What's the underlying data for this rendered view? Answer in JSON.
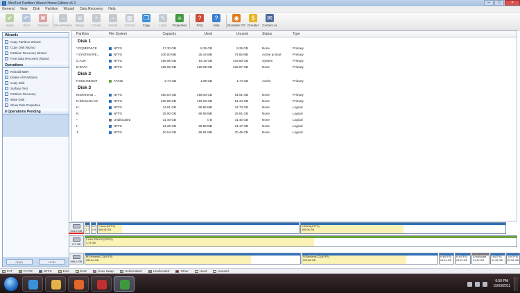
{
  "window": {
    "title": "MiniTool Partition Wizard Home Edition v5.2"
  },
  "menu": [
    "General",
    "View",
    "Disk",
    "Partition",
    "Wizard",
    "Data Recovery",
    "Help"
  ],
  "toolbar": [
    {
      "label": "Apply",
      "icon": "check-icon",
      "color": "#7aa64a",
      "enabled": false
    },
    {
      "label": "Undo",
      "icon": "undo-icon",
      "color": "#6b8fc0",
      "enabled": false
    },
    {
      "label": "Discard",
      "icon": "discard-icon",
      "color": "#c04040",
      "enabled": false
    },
    {
      "sep": true
    },
    {
      "label": "Move/Resize",
      "icon": "move-resize-icon",
      "color": "#8a97a8",
      "enabled": false
    },
    {
      "label": "Merge",
      "icon": "merge-icon",
      "color": "#8a97a8",
      "enabled": false
    },
    {
      "label": "Create",
      "icon": "create-icon",
      "color": "#8a97a8",
      "enabled": false
    },
    {
      "label": "Delete",
      "icon": "delete-icon",
      "color": "#8a97a8",
      "enabled": false
    },
    {
      "label": "Format",
      "icon": "format-icon",
      "color": "#8a97a8",
      "enabled": false
    },
    {
      "label": "Copy",
      "icon": "copy-icon",
      "color": "#3d8fd6",
      "enabled": true
    },
    {
      "label": "Label",
      "icon": "label-icon",
      "color": "#8a97a8",
      "enabled": false
    },
    {
      "label": "Properties",
      "icon": "properties-icon",
      "color": "#3f9a3f",
      "enabled": true
    },
    {
      "sep": true
    },
    {
      "label": "FAQ",
      "icon": "faq-icon",
      "color": "#d04a3c",
      "enabled": true
    },
    {
      "label": "Help",
      "icon": "help-icon",
      "color": "#3b7fd4",
      "enabled": true
    },
    {
      "sep": true
    },
    {
      "label": "Bootable CD",
      "icon": "bootable-cd-icon",
      "color": "#e07a1a",
      "enabled": true
    },
    {
      "label": "Donate!",
      "icon": "donate-icon",
      "color": "#e8b31c",
      "enabled": true
    },
    {
      "label": "Contact us",
      "icon": "contact-icon",
      "color": "#4d6a9a",
      "enabled": true
    }
  ],
  "sidebar": {
    "wizards_title": "Wizards",
    "wizards": [
      "Copy Partition Wizard",
      "Copy Disk Wizard",
      "Partition Recovery Wizard",
      "Free Data Recovery Wizard"
    ],
    "operations_title": "Operations",
    "operations": [
      "Rebuild MBR",
      "Delete All Partitions",
      "Copy Disk",
      "Surface Test",
      "Partition Recovery",
      "Wipe Disk",
      "Show Disk Properties"
    ],
    "pending_title": "0 Operations Pending",
    "apply_label": "Apply",
    "undo_label": "Undo"
  },
  "grid": {
    "columns": [
      "Partition",
      "File System",
      "Capacity",
      "Used",
      "Unused",
      "Status",
      "Type"
    ],
    "disks": [
      {
        "label": "Disk 1",
        "rows": [
          [
            "*:PQSERVICE",
            "NTFS",
            "17.30 GB",
            "8.25 GB",
            "9.25 GB",
            "None",
            "Primary"
          ],
          [
            "*:SYSTEM RE...",
            "NTFS",
            "100.00 MB",
            "25.44 MB",
            "74.55 MB",
            "Active & Boot",
            "Primary"
          ],
          [
            "C:Acer",
            "NTFS",
            "456.96 GB",
            "54.16 GB",
            "402.80 GB",
            "System",
            "Primary"
          ],
          [
            "D:DATA",
            "NTFS",
            "456.96 GB",
            "228.08 GB",
            "228.87 GB",
            "None",
            "Primary"
          ]
        ]
      },
      {
        "label": "Disk 2",
        "rows": [
          [
            "F:MULTIBOOT",
            "FAT32",
            "3.74 GB",
            "1.99 GB",
            "1.74 GB",
            "Active",
            "Primary"
          ]
        ]
      },
      {
        "label": "Disk 3",
        "rows": [
          [
            "M:Elements ...",
            "NTFS",
            "350.84 GB",
            "268.93 GB",
            "81.91 GB",
            "None",
            "Primary"
          ],
          [
            "N:Elements C2",
            "NTFS",
            "220.88 GB",
            "169.53 GB",
            "51.34 GB",
            "None",
            "Primary"
          ],
          [
            "H:",
            "NTFS",
            "24.81 GB",
            "86.86 MB",
            "24.73 GB",
            "None",
            "Logical"
          ],
          [
            "K:",
            "NTFS",
            "25.90 GB",
            "86.99 MB",
            "25.81 GB",
            "None",
            "Logical"
          ],
          [
            "*:",
            "Unallocated",
            "31.40 GB",
            "0 B",
            "31.40 GB",
            "None",
            "Logical"
          ],
          [
            "I:",
            "NTFS",
            "24.26 GB",
            "86.88 MB",
            "24.17 GB",
            "None",
            "Logical"
          ],
          [
            "J:",
            "NTFS",
            "20.54 GB",
            "86.81 MB",
            "20.45 GB",
            "None",
            "Logical"
          ]
        ]
      }
    ]
  },
  "fs_colors": {
    "NTFS": "#2f6fb6",
    "FAT32": "#6fa23a",
    "Unallocated": "#777777"
  },
  "diskmap": [
    {
      "disk_size": "931.5 GB",
      "parts": [
        {
          "label": "PQ",
          "size": "17.",
          "w": 8,
          "fill": 0.5
        },
        {
          "label": "SYS",
          "size": "100",
          "w": 8,
          "fill": 0.25
        },
        {
          "label": "C:Acer(NTFS)",
          "size": "456.96 GB",
          "w": 292,
          "fill": 0.12
        },
        {
          "label": "D:DATA(NTFS)",
          "size": "456.96 GB",
          "w": 297,
          "fill": 0.5
        }
      ]
    },
    {
      "disk_size": "3.7 GB",
      "parts": [
        {
          "label": "F:MULTIBOOT(FAT32)",
          "size": "3.74 GB",
          "w": 624,
          "fill": 0.53,
          "fat": true
        }
      ]
    },
    {
      "disk_size": "698.6 GB",
      "parts": [
        {
          "label": "M:Elements C1(NTFS)",
          "size": "350.84 GB",
          "w": 312,
          "fill": 0.77
        },
        {
          "label": "N:Elements C2(NTFS)",
          "size": "220.88 GB",
          "w": 197,
          "fill": 0.77
        },
        {
          "label": "H:(NTFS)",
          "size": "24.81 GB",
          "w": 22,
          "fill": 0.05
        },
        {
          "label": "K:(NTFS)",
          "size": "25.90 GB",
          "w": 23,
          "fill": 0.05
        },
        {
          "label": "(Unallocate",
          "size": "31.40 GB",
          "w": 26,
          "fill": 0,
          "unalloc": true
        },
        {
          "label": "I:(NTFS)",
          "size": "24.26 GB",
          "w": 22,
          "fill": 0.05
        },
        {
          "label": "J:(NTFS)",
          "size": "20.54 GB",
          "w": 20,
          "fill": 0.05
        }
      ]
    }
  ],
  "legend": [
    {
      "label": "FAT",
      "color": "#c8d8a8"
    },
    {
      "label": "FAT32",
      "color": "#7fae3f"
    },
    {
      "label": "NTFS",
      "color": "#2f6fb6"
    },
    {
      "label": "Ext2",
      "color": "#e0c070"
    },
    {
      "label": "Ext3",
      "color": "#e6e070"
    },
    {
      "label": "Linux Swap",
      "color": "#c070c0"
    },
    {
      "label": "Unformatted",
      "color": "#a0c0d0"
    },
    {
      "label": "Unallocated",
      "color": "#888888"
    },
    {
      "label": "Other",
      "color": "#a02020"
    },
    {
      "label": "Used",
      "color": "#fbf3b5"
    },
    {
      "label": "Unused",
      "color": "#ffffff"
    }
  ],
  "taskbar": {
    "apps": [
      {
        "name": "ie-taskbar-icon",
        "color": "#3a8fd9"
      },
      {
        "name": "explorer-taskbar-icon",
        "color": "#e3b34a"
      },
      {
        "name": "media-player-taskbar-icon",
        "color": "#e0662a"
      },
      {
        "name": "app-taskbar-icon",
        "color": "#c03030"
      },
      {
        "name": "partition-wizard-taskbar-icon",
        "color": "#3f9a3f"
      }
    ],
    "time": "6:50 PM",
    "date": "15/03/2011"
  }
}
